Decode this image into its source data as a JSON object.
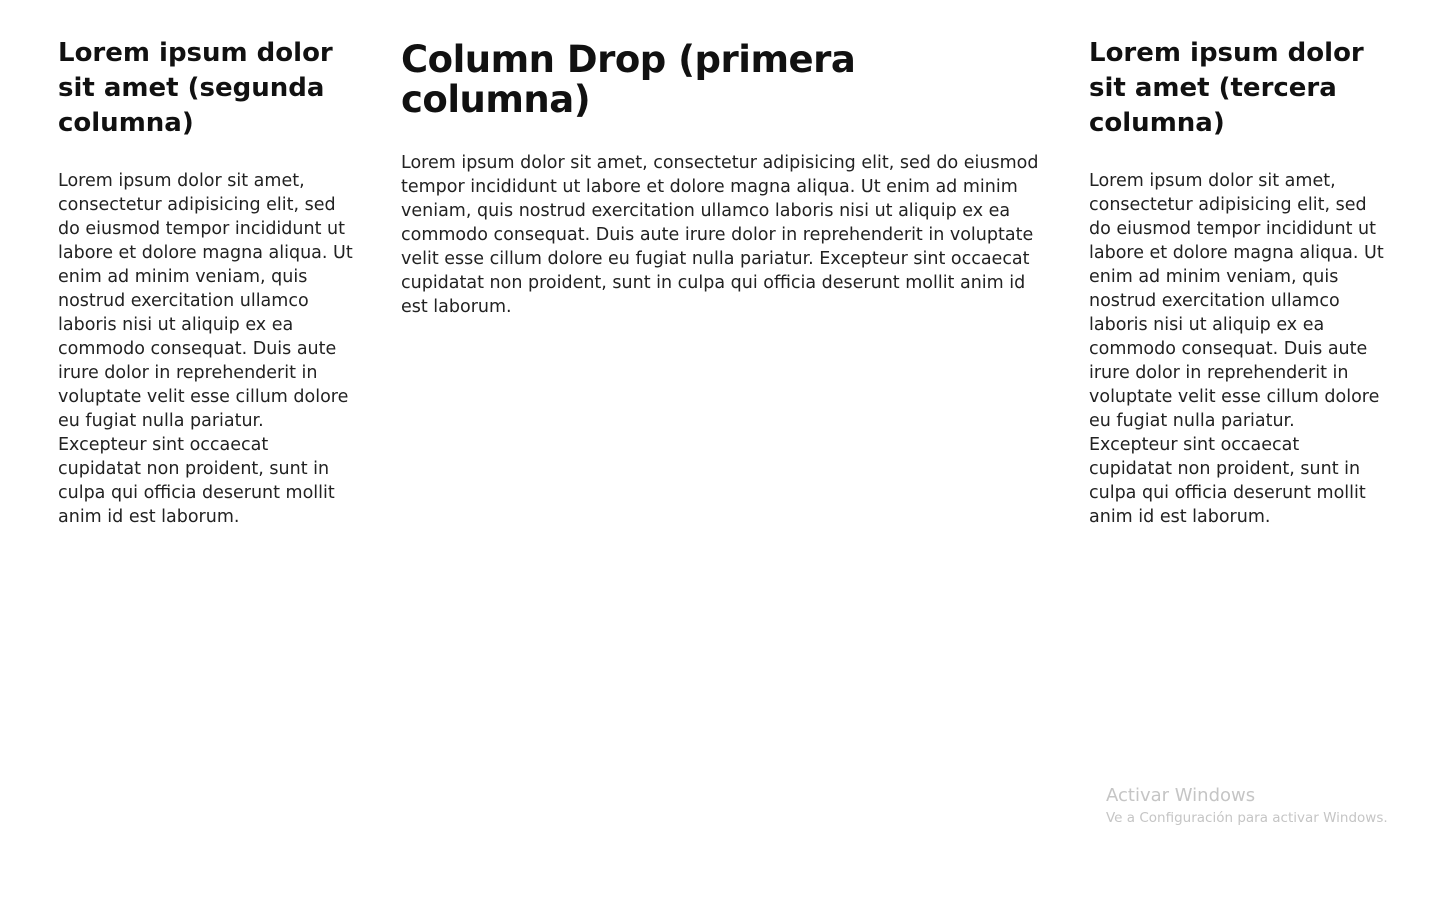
{
  "primary": {
    "heading": "Column Drop (primera columna)",
    "text": "Lorem ipsum dolor sit amet, consectetur adipisicing elit, sed do eiusmod tempor incididunt ut labore et dolore magna aliqua. Ut enim ad minim veniam, quis nostrud exercitation ullamco laboris nisi ut aliquip ex ea commodo consequat. Duis aute irure dolor in reprehenderit in voluptate velit esse cillum dolore eu fugiat nulla pariatur. Excepteur sint occaecat cupidatat non proident, sunt in culpa qui officia deserunt mollit anim id est laborum."
  },
  "secondary": {
    "heading": "Lorem ipsum dolor sit amet (segunda columna)",
    "text": "Lorem ipsum dolor sit amet, consectetur adipisicing elit, sed do eiusmod tempor incididunt ut labore et dolore magna aliqua. Ut enim ad minim veniam, quis nostrud exercitation ullamco laboris nisi ut aliquip ex ea commodo consequat. Duis aute irure dolor in reprehenderit in voluptate velit esse cillum dolore eu fugiat nulla pariatur. Excepteur sint occaecat cupidatat non proident, sunt in culpa qui officia deserunt mollit anim id est laborum."
  },
  "tertiary": {
    "heading": "Lorem ipsum dolor sit amet (tercera columna)",
    "text": "Lorem ipsum dolor sit amet, consectetur adipisicing elit, sed do eiusmod tempor incididunt ut labore et dolore magna aliqua. Ut enim ad minim veniam, quis nostrud exercitation ullamco laboris nisi ut aliquip ex ea commodo consequat. Duis aute irure dolor in reprehenderit in voluptate velit esse cillum dolore eu fugiat nulla pariatur. Excepteur sint occaecat cupidatat non proident, sunt in culpa qui officia deserunt mollit anim id est laborum."
  },
  "windows_activation": {
    "title": "Activar Windows",
    "subtitle": "Ve a Configuración para activar Windows."
  }
}
